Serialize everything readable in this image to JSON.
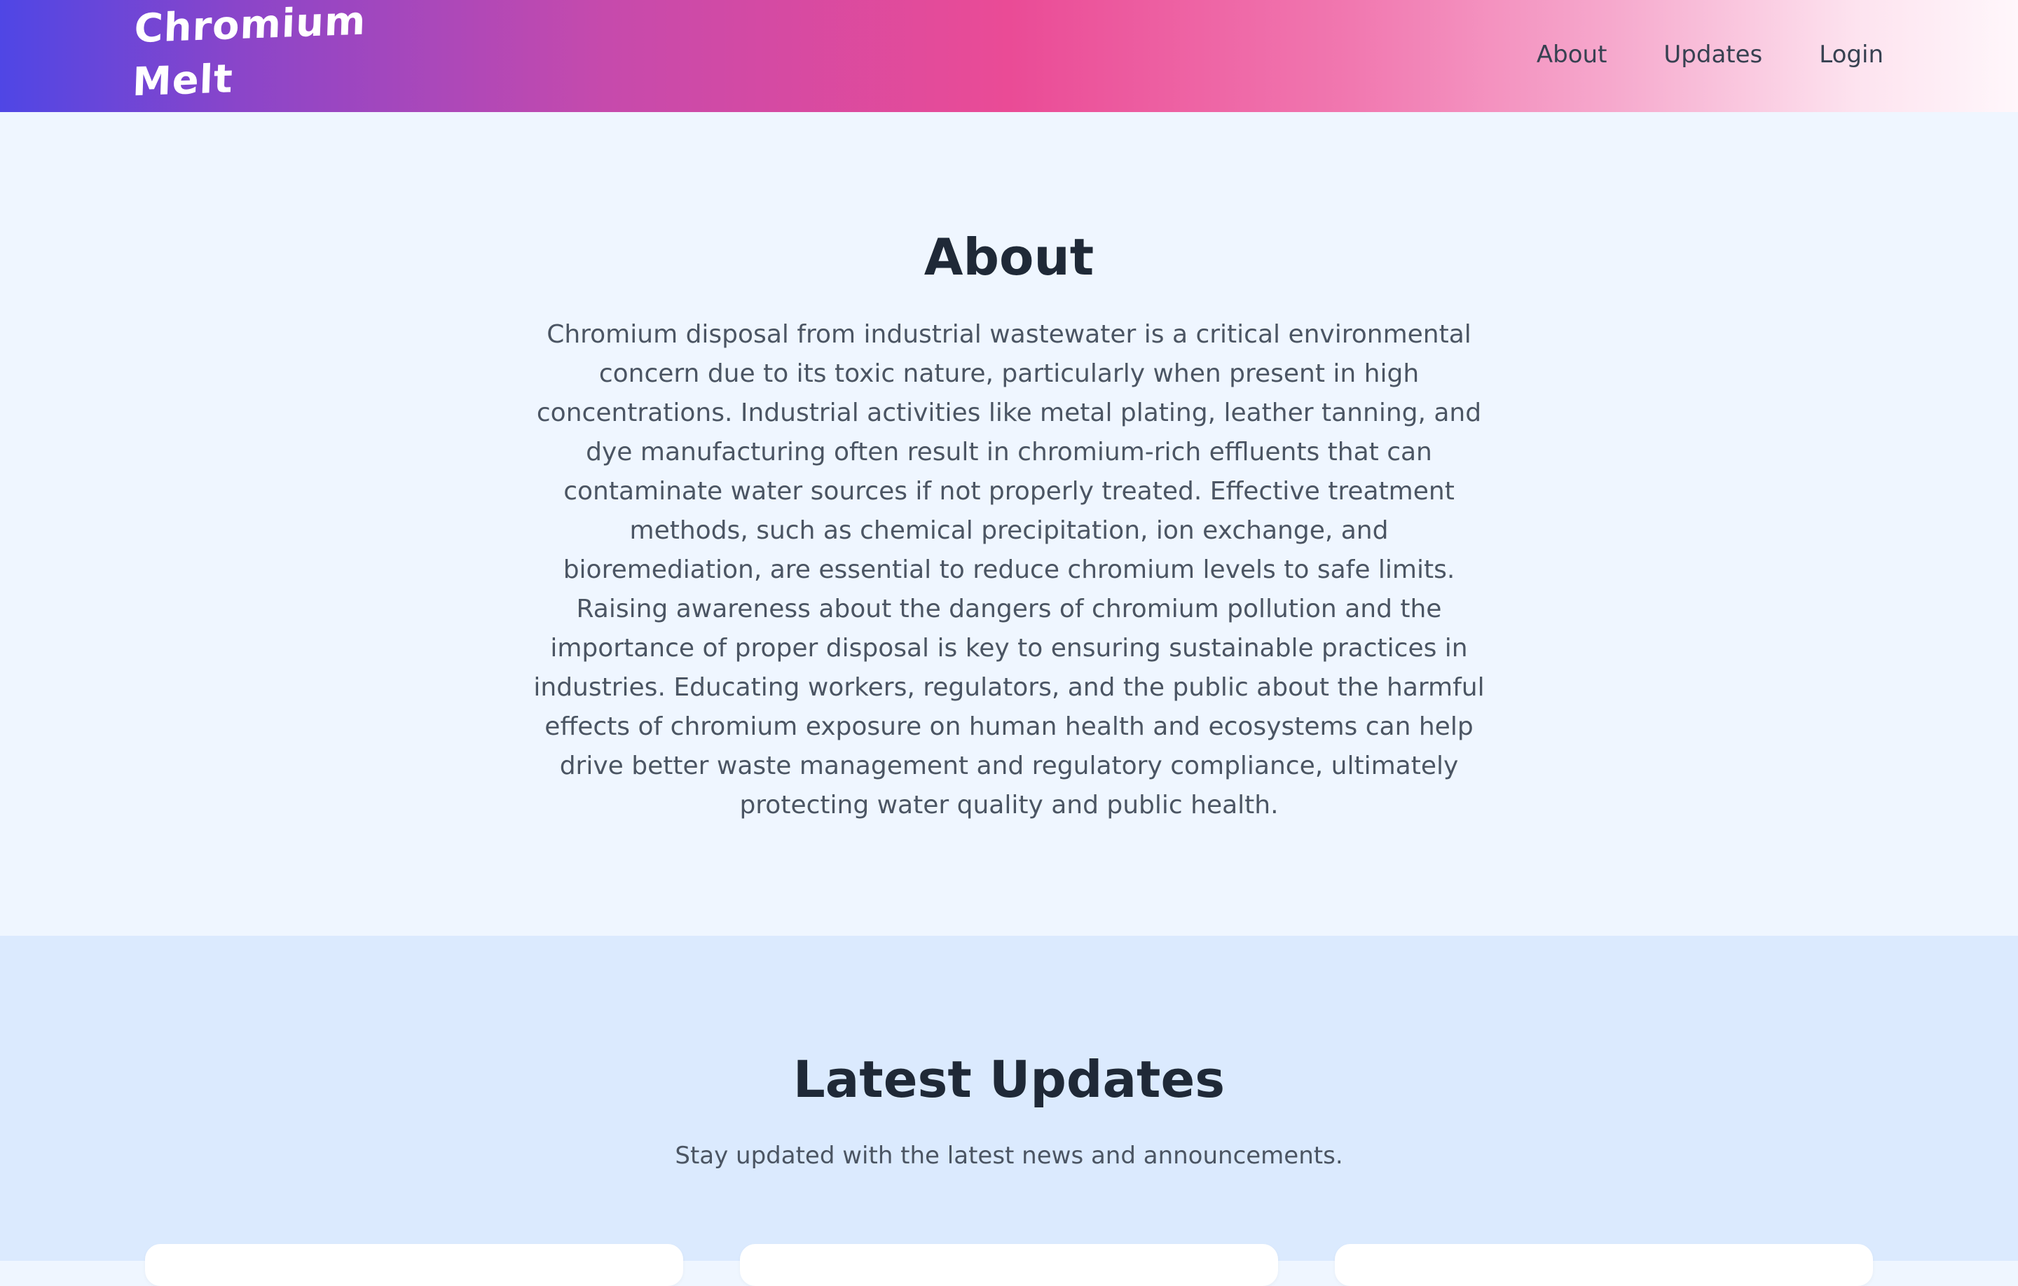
{
  "header": {
    "brand_line1": "Chromium",
    "brand_line2": "Melt",
    "nav": [
      {
        "label": "About"
      },
      {
        "label": "Updates"
      },
      {
        "label": "Login"
      }
    ],
    "gradient_colors": [
      "#4f46e5",
      "#ec4899",
      "#fdf2f8"
    ]
  },
  "about": {
    "title": "About",
    "body": "Chromium disposal from industrial wastewater is a critical environmental concern due to its toxic nature, particularly when present in high concentrations. Industrial activities like metal plating, leather tanning, and dye manufacturing often result in chromium-rich effluents that can contaminate water sources if not properly treated. Effective treatment methods, such as chemical precipitation, ion exchange, and bioremediation, are essential to reduce chromium levels to safe limits. Raising awareness about the dangers of chromium pollution and the importance of proper disposal is key to ensuring sustainable practices in industries. Educating workers, regulators, and the public about the harmful effects of chromium exposure on human health and ecosystems can help drive better waste management and regulatory compliance, ultimately protecting water quality and public health."
  },
  "updates": {
    "title": "Latest Updates",
    "subtitle": "Stay updated with the latest news and announcements."
  }
}
